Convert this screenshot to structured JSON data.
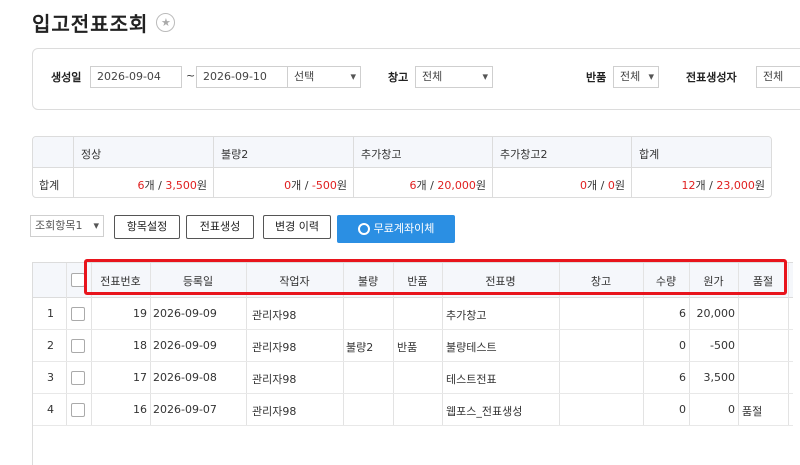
{
  "page": {
    "title": "입고전표조회"
  },
  "filters": {
    "created_label": "생성일",
    "date_from": "2026-09-04",
    "tilde": "~",
    "date_to": "2026-09-10",
    "period_select": "선택",
    "warehouse_label": "창고",
    "warehouse_value": "전체",
    "return_label": "반품",
    "return_value": "전체",
    "creator_label": "전표생성자",
    "creator_value": "전체"
  },
  "summary": {
    "headers": [
      "정상",
      "불량2",
      "추가창고",
      "추가창고2",
      "합계"
    ],
    "row_label": "합계",
    "cells": [
      {
        "count": "6",
        "amount": "3,500"
      },
      {
        "count": "0",
        "amount": "-500"
      },
      {
        "count": "6",
        "amount": "20,000"
      },
      {
        "count": "0",
        "amount": "0"
      },
      {
        "count": "12",
        "amount": "23,000"
      }
    ],
    "count_unit": "개",
    "sep": " / ",
    "amount_unit": "원"
  },
  "toolbar": {
    "view_select": "조회항목1",
    "item_settings": "항목설정",
    "create_slip": "전표생성",
    "change_history": "변경 이력",
    "free_transfer": "무료계좌이체"
  },
  "table": {
    "headers": [
      "전표번호",
      "등록일",
      "작업자",
      "불량",
      "반품",
      "전표명",
      "창고",
      "수량",
      "원가",
      "품절"
    ],
    "rows": [
      {
        "idx": "1",
        "no": "19",
        "date": "2026-09-09",
        "worker": "관리자98",
        "defect": "",
        "ret": "",
        "name": "추가창고",
        "wh": "",
        "qty": "6",
        "cost": "20,000",
        "soldout": ""
      },
      {
        "idx": "2",
        "no": "18",
        "date": "2026-09-09",
        "worker": "관리자98",
        "defect": "불량2",
        "ret": "반품",
        "name": "불량테스트",
        "wh": "",
        "qty": "0",
        "cost": "-500",
        "soldout": ""
      },
      {
        "idx": "3",
        "no": "17",
        "date": "2026-09-08",
        "worker": "관리자98",
        "defect": "",
        "ret": "",
        "name": "테스트전표",
        "wh": "",
        "qty": "6",
        "cost": "3,500",
        "soldout": ""
      },
      {
        "idx": "4",
        "no": "16",
        "date": "2026-09-07",
        "worker": "관리자98",
        "defect": "",
        "ret": "",
        "name": "웹포스_전표생성",
        "wh": "",
        "qty": "0",
        "cost": "0",
        "soldout": "품절"
      }
    ]
  },
  "colors": {
    "accent": "#2b8fe3",
    "highlight": "#e8141c",
    "red_text": "#e02020"
  },
  "icons": {
    "favorite": "star-icon",
    "transfer": "transfer-icon"
  }
}
